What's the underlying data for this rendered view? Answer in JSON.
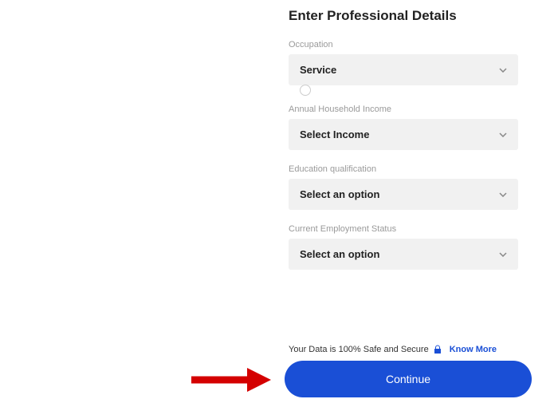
{
  "form": {
    "title": "Enter Professional Details",
    "fields": {
      "occupation": {
        "label": "Occupation",
        "value": "Service"
      },
      "income": {
        "label": "Annual Household Income",
        "value": "Select Income"
      },
      "education": {
        "label": "Education qualification",
        "value": "Select an option"
      },
      "employment": {
        "label": "Current Employment Status",
        "value": "Select an option"
      }
    }
  },
  "safety": {
    "text": "Your Data is 100% Safe and Secure",
    "know_more": "Know More"
  },
  "continue_label": "Continue"
}
